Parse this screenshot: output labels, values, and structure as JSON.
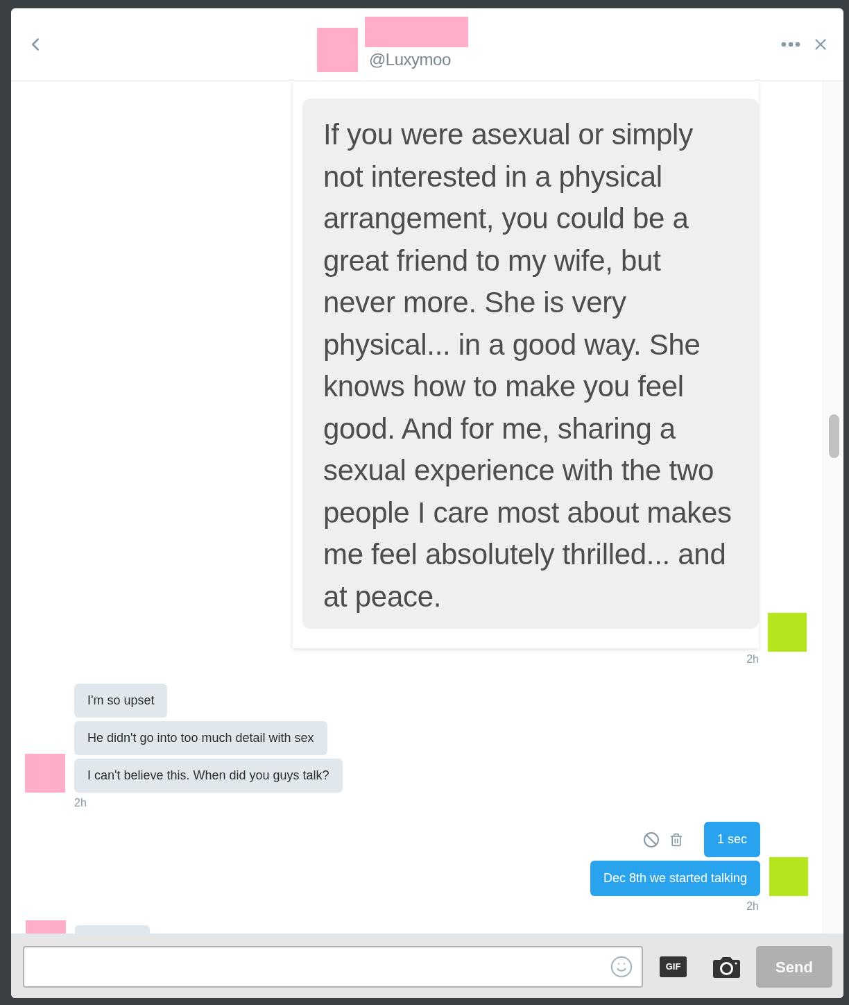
{
  "header": {
    "handle": "@Luxymoo"
  },
  "messages": [
    {
      "sent": true,
      "time": "2h",
      "bubbles": [
        {
          "kind": "screenshot",
          "text": "If you were asexual or simply not interested in a physical arrangement, you could be a great friend to my wife, but never more. She is very physical... in a good way. She knows how to make you feel good. And for me, sharing a sexual experience with the two people I care most about makes me feel absolutely thrilled... and at peace.",
          "hovered": false
        }
      ]
    },
    {
      "sent": false,
      "time": "2h",
      "bubbles": [
        {
          "kind": "text",
          "text": "I'm so upset",
          "hovered": false
        },
        {
          "kind": "text",
          "text": "He didn't go into too much detail with sex",
          "hovered": false
        },
        {
          "kind": "text",
          "text": "I can't believe this. When did you guys talk?",
          "hovered": false
        }
      ]
    },
    {
      "sent": true,
      "time": "2h",
      "bubbles": [
        {
          "kind": "text",
          "text": "1 sec",
          "hovered": true
        },
        {
          "kind": "text",
          "text": "Dec 8th we started talking",
          "hovered": false
        }
      ]
    },
    {
      "sent": false,
      "bubbles": [
        {
          "kind": "partial"
        }
      ]
    }
  ],
  "composer": {
    "gif_label": "GIF",
    "send_label": "Send",
    "send_disabled": true
  }
}
